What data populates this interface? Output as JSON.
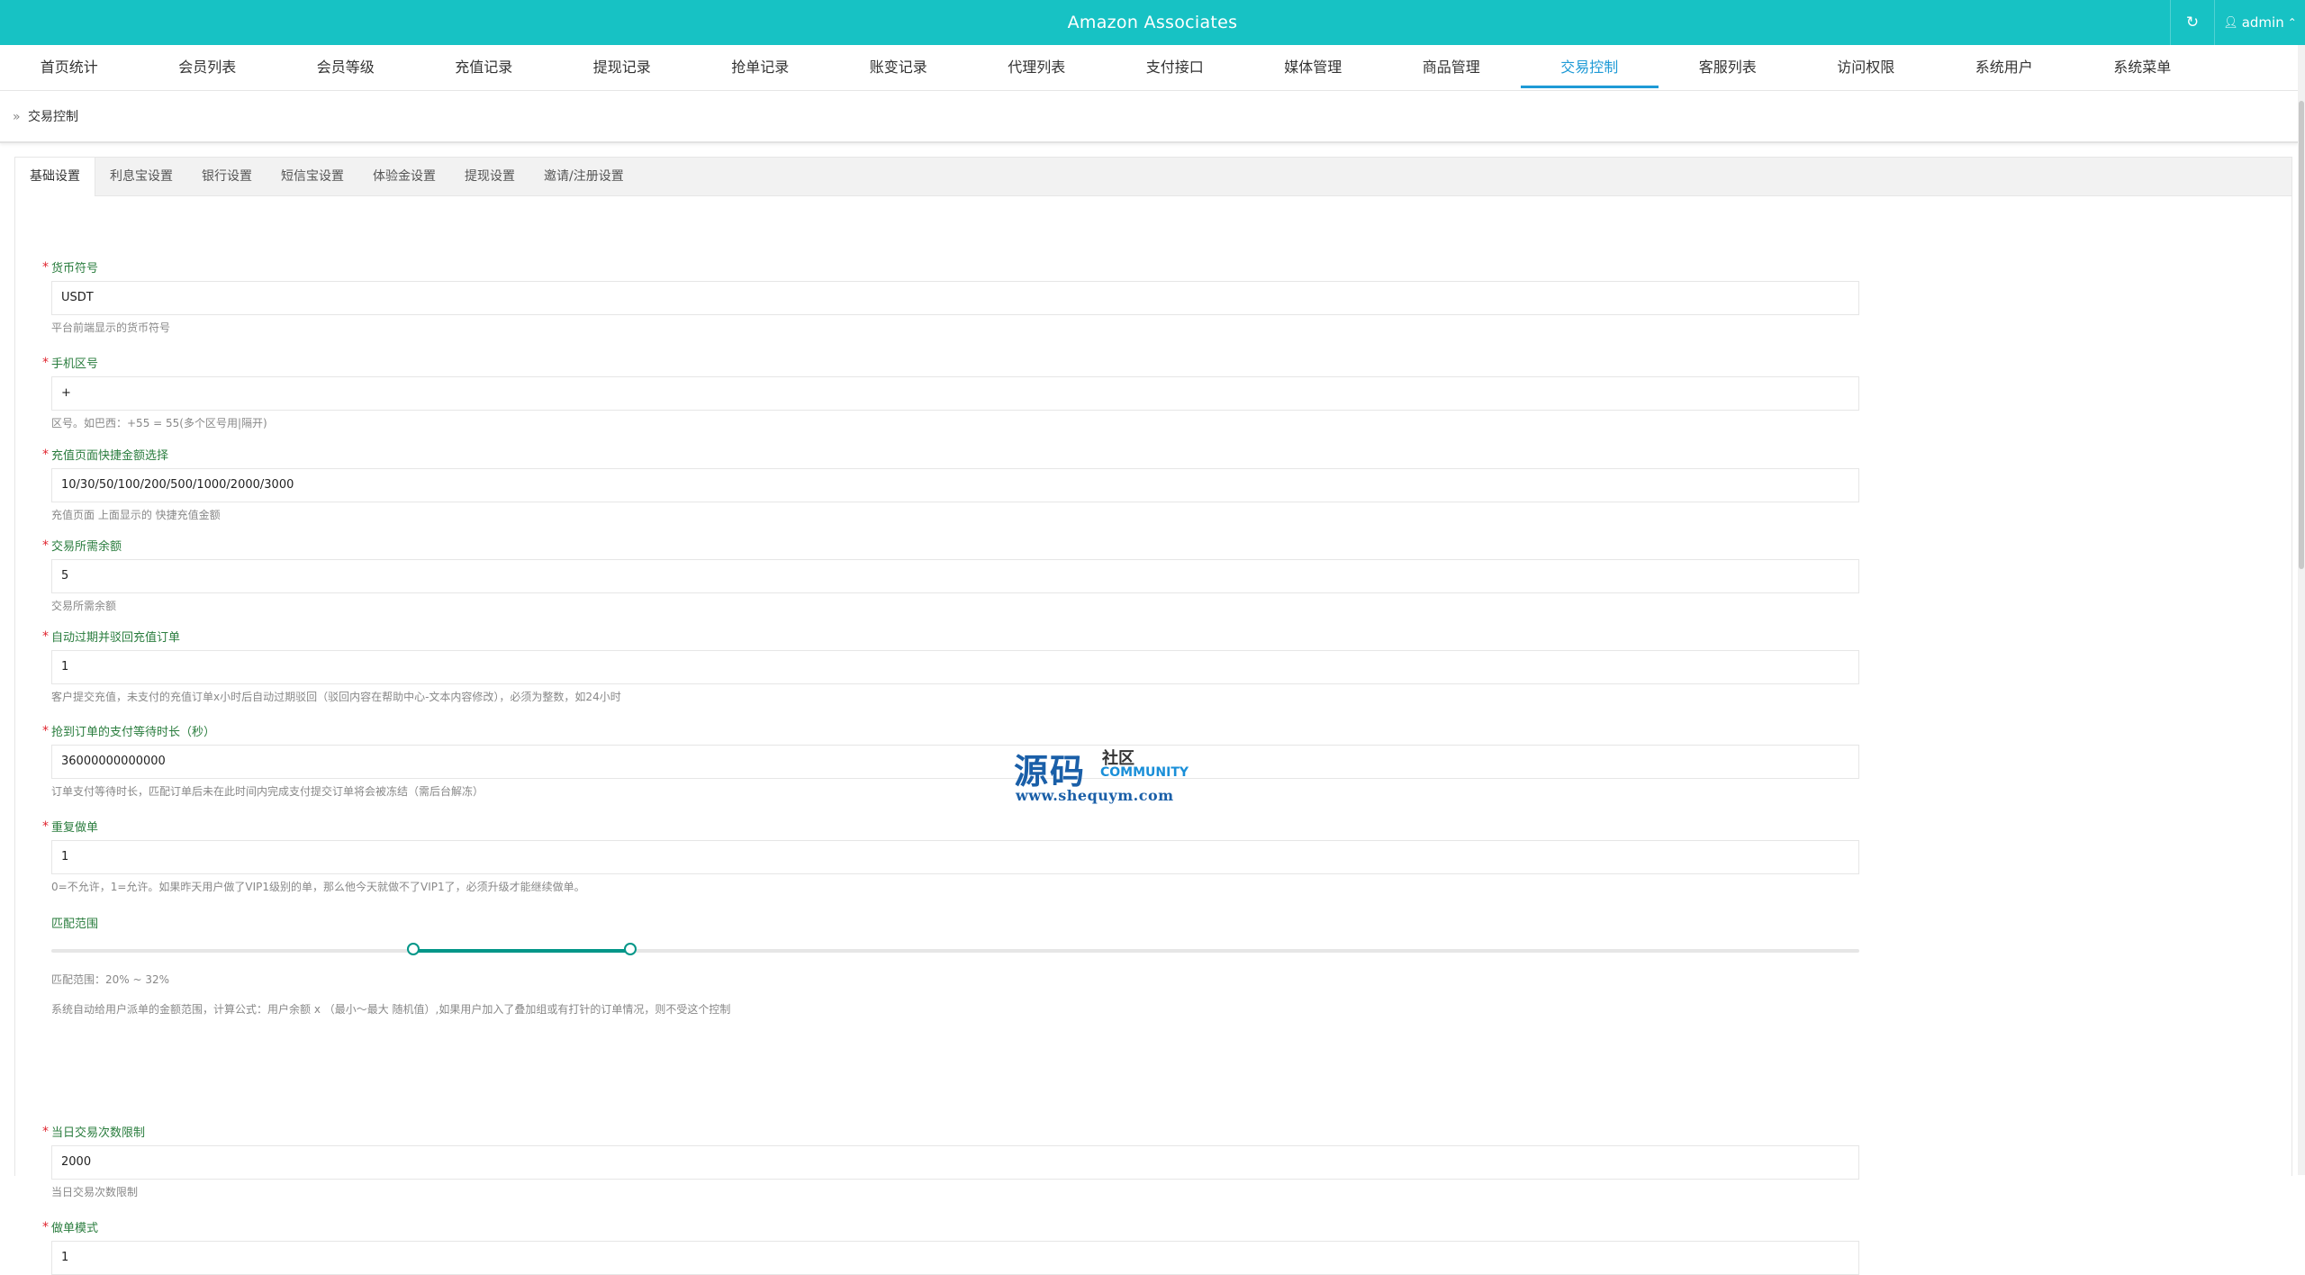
{
  "app": {
    "title": "Amazon Associates",
    "user": "admin",
    "refresh_icon": "refresh-icon",
    "user_icon": "user-icon",
    "chevron_icon": "chevron-up-icon"
  },
  "nav": {
    "items": [
      "首页统计",
      "会员列表",
      "会员等级",
      "充值记录",
      "提现记录",
      "抢单记录",
      "账变记录",
      "代理列表",
      "支付接口",
      "媒体管理",
      "商品管理",
      "交易控制",
      "客服列表",
      "访问权限",
      "系统用户",
      "系统菜单"
    ],
    "active_index": 11
  },
  "breadcrumb": {
    "sep": "»",
    "current": "交易控制"
  },
  "tabs": [
    "基础设置",
    "利息宝设置",
    "银行设置",
    "短信宝设置",
    "体验金设置",
    "提现设置",
    "邀请/注册设置"
  ],
  "form": {
    "currency": {
      "label": "货币符号",
      "value": "USDT",
      "help": "平台前端显示的货币符号"
    },
    "phone_code": {
      "label": "手机区号",
      "value": "+",
      "help": "区号。如巴西：+55 = 55(多个区号用|隔开)"
    },
    "quick_amounts": {
      "label": "充值页面快捷金额选择",
      "value": "10/30/50/100/200/500/1000/2000/3000",
      "help": "充值页面 上面显示的 快捷充值金额"
    },
    "min_balance": {
      "label": "交易所需余额",
      "value": "5",
      "help": "交易所需余额"
    },
    "auto_expire": {
      "label": "自动过期并驳回充值订单",
      "value": "1",
      "help": "客户提交充值，未支付的充值订单x小时后自动过期驳回（驳回内容在帮助中心-文本内容修改），必须为整数，如24小时"
    },
    "wait_time": {
      "label": "抢到订单的支付等待时长（秒）",
      "value": "36000000000000",
      "help": "订单支付等待时长，匹配订单后未在此时间内完成支付提交订单将会被冻结（需后台解冻）"
    },
    "repeat": {
      "label": "重复做单",
      "value": "1",
      "help": "0=不允许，1=允许。如果昨天用户做了VIP1级别的单，那么他今天就做不了VIP1了，必须升级才能继续做单。"
    },
    "match_range": {
      "label": "匹配范围",
      "min": 20,
      "max": 32,
      "help1": "匹配范围：20% ~ 32%",
      "help2": "系统自动给用户派单的金额范围，计算公式：用户余额 x （最小～最大 随机值）,如果用户加入了叠加组或有打针的订单情况，则不受这个控制"
    },
    "daily_limit": {
      "label": "当日交易次数限制",
      "value": "2000",
      "help": "当日交易次数限制"
    },
    "mode": {
      "label": "做单模式",
      "value": "1"
    }
  },
  "watermark": {
    "big": "源码",
    "cn": "社区",
    "en": "COMMUNITY",
    "url": "www.shequym.com"
  }
}
